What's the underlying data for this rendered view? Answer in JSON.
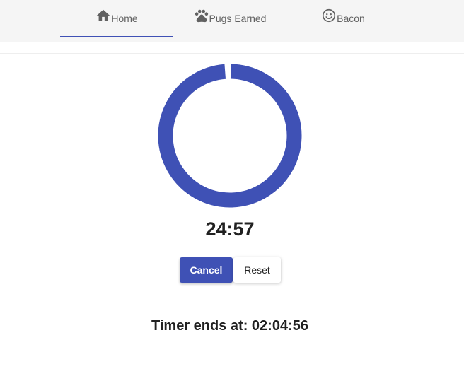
{
  "nav": {
    "tabs": [
      {
        "label": "Home",
        "icon": "home-icon",
        "active": true
      },
      {
        "label": "Pugs Earned",
        "icon": "paw-icon",
        "active": false
      },
      {
        "label": "Bacon",
        "icon": "smiley-icon",
        "active": false
      }
    ]
  },
  "timer": {
    "display": "24:57",
    "progress": 0.99,
    "ring_color": "#3f51b5"
  },
  "actions": {
    "cancel_label": "Cancel",
    "reset_label": "Reset"
  },
  "footer": {
    "ends_text": "Timer ends at: 02:04:56"
  },
  "colors": {
    "accent": "#3f51b5"
  }
}
